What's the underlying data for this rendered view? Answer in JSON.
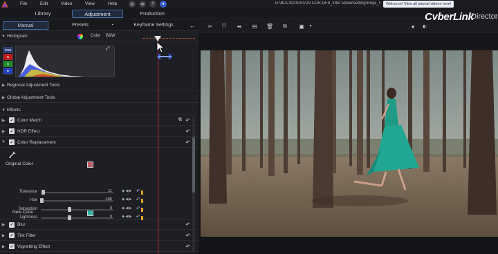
{
  "menu": {
    "file": "File",
    "edit": "Edit",
    "video": "Video",
    "view": "View",
    "help": "Help"
  },
  "path": "D:\\BCL3\\20190729 CDR-DF8_Intro Video\\setting\\Roya_f4...",
  "welcome": "Welcome! View all tutorial videos here!",
  "main_tabs": {
    "library": "Library",
    "adjustment": "Adjustment",
    "production": "Production"
  },
  "brand": {
    "name": "CyberLink",
    "product": "Director"
  },
  "sub_tabs": {
    "manual": "Manual",
    "presets": "Presets",
    "keyframe": "Keyframe Settings"
  },
  "histogram": {
    "title": "Histogram",
    "color_label": "Color",
    "bw_label": "B&W",
    "channels": [
      "RGB",
      "R",
      "G",
      "B"
    ]
  },
  "sections": {
    "regional": "Regional Adjustment Tools",
    "global": "Global Adjustment Tools",
    "effects": "Effects"
  },
  "effects": {
    "color_match": "Color Match",
    "hdr": "HDR Effect",
    "color_replacement": "Color Replacement",
    "blur": "Blur",
    "tint": "Tint Filter",
    "vignetting": "Vignetting Effect"
  },
  "color_replacement": {
    "original_color_label": "Original Color",
    "new_color_label": "New Color",
    "original_color": "#c05a6a",
    "new_color": "#39b3a8",
    "sliders": [
      {
        "label": "Tolerance",
        "value": "11",
        "fraction": 0.02
      },
      {
        "label": "Hue",
        "value": "-180",
        "fraction": 0.0
      },
      {
        "label": "Saturation",
        "value": "0",
        "fraction": 0.5
      },
      {
        "label": "Lightness",
        "value": "0",
        "fraction": 0.5
      }
    ]
  },
  "colors": {
    "accent": "#4a6ea8",
    "playhead": "#c5253a",
    "keyframe_mark": "#e4a221"
  }
}
